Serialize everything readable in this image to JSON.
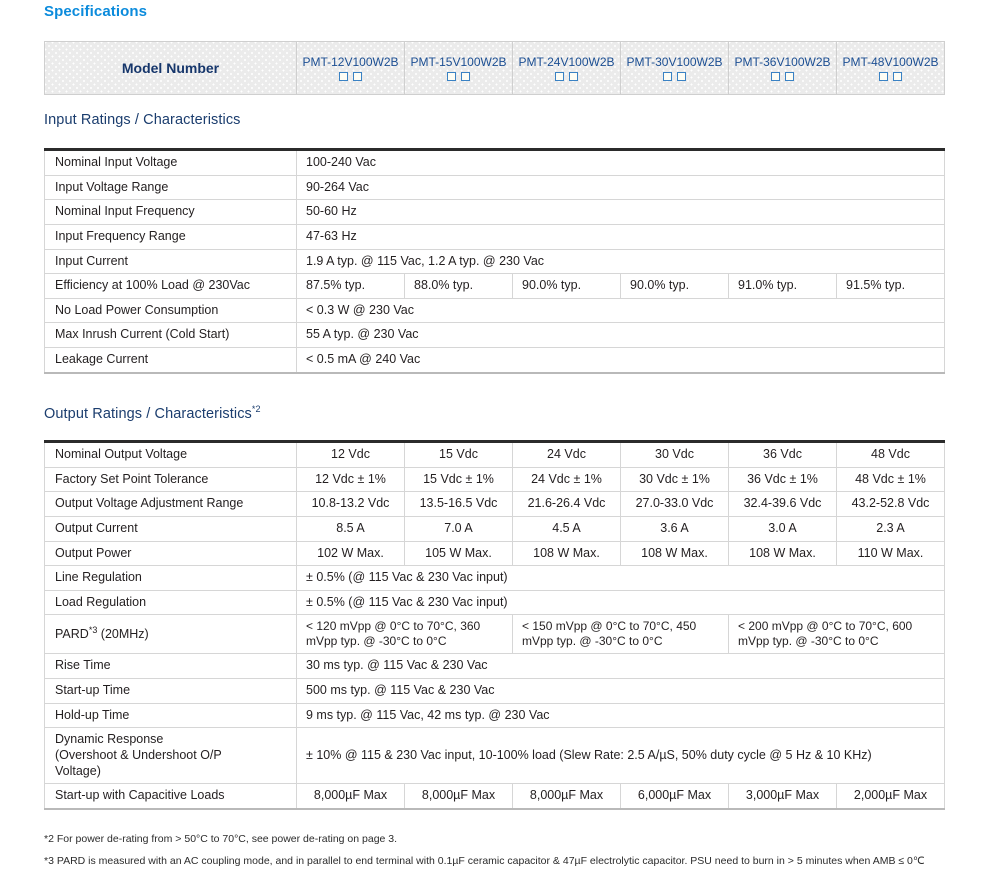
{
  "titles": {
    "specifications": "Specifications",
    "input_section": "Input Ratings / Characteristics",
    "output_section": "Output Ratings / Characteristics",
    "output_section_sup": "*2"
  },
  "colors": {
    "spec_title": "#0b8bdc",
    "section_title": "#1b3d6e",
    "model_label": "#16366b",
    "model_name": "#1c4f93",
    "header_bg": "#ebebeb",
    "border": "#d6d6d6",
    "rule_dark": "#2b2b2b"
  },
  "model_header": {
    "label": "Model Number",
    "models": [
      "PMT-12V100W2B",
      "PMT-15V100W2B",
      "PMT-24V100W2B",
      "PMT-30V100W2B",
      "PMT-36V100W2B",
      "PMT-48V100W2B"
    ],
    "checkbox_count_per_model": 2
  },
  "input_table": {
    "rows": [
      {
        "label": "Nominal Input Voltage",
        "span": "full",
        "value": "100-240 Vac"
      },
      {
        "label": "Input Voltage Range",
        "span": "full",
        "value": "90-264 Vac"
      },
      {
        "label": "Nominal Input Frequency",
        "span": "full",
        "value": "50-60 Hz"
      },
      {
        "label": "Input Frequency Range",
        "span": "full",
        "value": "47-63 Hz"
      },
      {
        "label": "Input Current",
        "span": "full",
        "value": "1.9 A typ. @ 115 Vac, 1.2 A typ. @ 230 Vac"
      },
      {
        "label": "Efficiency at 100% Load @ 230Vac",
        "span": "per-model",
        "values": [
          "87.5% typ.",
          "88.0% typ.",
          "90.0% typ.",
          "90.0% typ.",
          "91.0% typ.",
          "91.5% typ."
        ]
      },
      {
        "label": "No Load Power Consumption",
        "span": "full",
        "value": "< 0.3 W @ 230 Vac"
      },
      {
        "label": "Max Inrush Current (Cold Start)",
        "span": "full",
        "value": "55 A typ. @ 230 Vac"
      },
      {
        "label": "Leakage Current",
        "span": "full",
        "value": "< 0.5 mA @ 240 Vac"
      }
    ]
  },
  "output_table": {
    "rows": [
      {
        "label": "Nominal Output Voltage",
        "span": "per-model",
        "values": [
          "12 Vdc",
          "15 Vdc",
          "24 Vdc",
          "30 Vdc",
          "36 Vdc",
          "48 Vdc"
        ]
      },
      {
        "label": "Factory Set Point Tolerance",
        "span": "per-model",
        "values": [
          "12 Vdc ± 1%",
          "15 Vdc ± 1%",
          "24 Vdc ± 1%",
          "30 Vdc ± 1%",
          "36 Vdc ± 1%",
          "48 Vdc ± 1%"
        ]
      },
      {
        "label": "Output Voltage Adjustment Range",
        "span": "per-model",
        "values": [
          "10.8-13.2 Vdc",
          "13.5-16.5 Vdc",
          "21.6-26.4 Vdc",
          "27.0-33.0 Vdc",
          "32.4-39.6 Vdc",
          "43.2-52.8 Vdc"
        ]
      },
      {
        "label": "Output Current",
        "span": "per-model",
        "values": [
          "8.5 A",
          "7.0 A",
          "4.5 A",
          "3.6 A",
          "3.0 A",
          "2.3 A"
        ]
      },
      {
        "label": "Output Power",
        "span": "per-model",
        "values": [
          "102 W Max.",
          "105 W Max.",
          "108 W Max.",
          "108 W Max.",
          "108 W Max.",
          "110 W Max."
        ]
      },
      {
        "label": "Line Regulation",
        "span": "full",
        "value": "± 0.5%  (@ 115 Vac & 230 Vac input)"
      },
      {
        "label": "Load Regulation",
        "span": "full",
        "value": "± 0.5%  (@ 115 Vac & 230 Vac input)"
      },
      {
        "label": "PARD*3 (20MHz)",
        "label_base": "PARD",
        "label_sup": "*3",
        "label_tail": " (20MHz)",
        "span": "pair",
        "values": [
          "< 120 mVpp @ 0°C to 70°C, 360 mVpp typ. @ -30°C to 0°C",
          "< 150 mVpp @ 0°C to 70°C, 450 mVpp typ. @ -30°C to 0°C",
          "< 200 mVpp @ 0°C to 70°C, 600 mVpp typ. @ -30°C to 0°C"
        ]
      },
      {
        "label": "Rise Time",
        "span": "full",
        "value": "30 ms typ. @ 115 Vac & 230 Vac"
      },
      {
        "label": "Start-up Time",
        "span": "full",
        "value": "500 ms typ. @ 115 Vac & 230 Vac"
      },
      {
        "label": "Hold-up Time",
        "span": "full",
        "value": "9 ms typ. @ 115 Vac, 42 ms typ. @ 230 Vac"
      },
      {
        "label": "Dynamic Response (Overshoot & Undershoot O/P Voltage)",
        "label_lines": [
          "Dynamic Response",
          "(Overshoot & Undershoot O/P",
          "Voltage)"
        ],
        "span": "full",
        "value": "± 10% @ 115 & 230 Vac input, 10-100% load (Slew Rate: 2.5 A/µS, 50% duty cycle @ 5 Hz & 10 KHz)"
      },
      {
        "label": "Start-up with Capacitive Loads",
        "span": "per-model",
        "values": [
          "8,000µF Max",
          "8,000µF Max",
          "8,000µF Max",
          "6,000µF Max",
          "3,000µF Max",
          "2,000µF Max"
        ]
      }
    ]
  },
  "notes": [
    "*2 For power de-rating from > 50°C to 70°C, see power de-rating on page 3.",
    "*3 PARD is measured with an AC coupling mode, and in parallel to end terminal with 0.1µF ceramic capacitor & 47µF electrolytic capacitor. PSU need to burn in > 5 minutes when AMB ≤ 0℃"
  ]
}
